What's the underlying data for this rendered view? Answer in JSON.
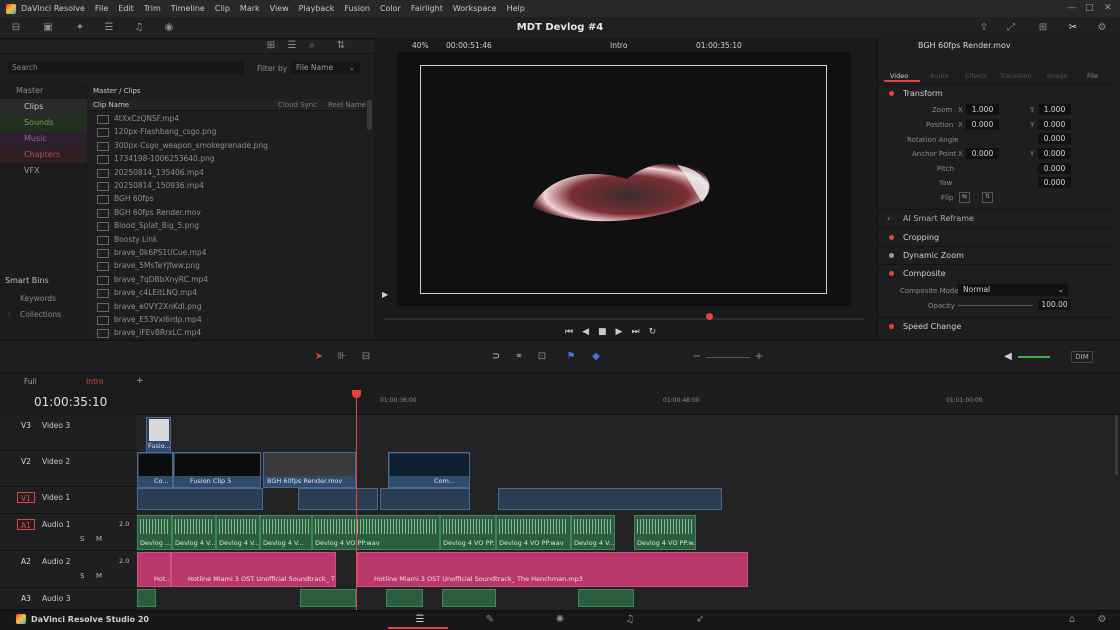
{
  "app": {
    "name": "DaVinci Resolve",
    "edition": "DaVinci Resolve Studio 20",
    "project_title": "MDT Devlog #4"
  },
  "menu": [
    "DaVinci Resolve",
    "File",
    "Edit",
    "Trim",
    "Timeline",
    "Clip",
    "Mark",
    "View",
    "Playback",
    "Fusion",
    "Color",
    "Fairlight",
    "Workspace",
    "Help"
  ],
  "media_pool": {
    "search_placeholder": "Search",
    "filter_label": "Filter by",
    "filter_value": "File Name",
    "path": "Master / Clips",
    "columns": [
      "Clip Name",
      "Cloud Sync",
      "Reel Name"
    ],
    "bins": [
      {
        "label": "Master",
        "color": "#8a8a8c"
      },
      {
        "label": "Clips",
        "color": "#d0d0d2"
      },
      {
        "label": "Sounds",
        "color": "#6fa35a"
      },
      {
        "label": "Music",
        "color": "#a35aa8"
      },
      {
        "label": "Chapters",
        "color": "#b2506a"
      },
      {
        "label": "VFX",
        "color": "#9a9a9c"
      }
    ],
    "smart_bins_title": "Smart Bins",
    "smart_bins": [
      "Keywords",
      "Collections"
    ],
    "clips": [
      "4tXxCzQNSF.mp4",
      "120px-Flashbang_csgo.png",
      "300px-Csgo_weapon_smokegrenade.png",
      "1734198-1006253640.png",
      "20250814_135406.mp4",
      "20250814_150936.mp4",
      "BGH 60fps",
      "BGH 60fps Render.mov",
      "Blood_Splat_Big_5.png",
      "Boosty Link",
      "brave_0k6PS1UCue.mp4",
      "brave_5MsTeYJfww.png",
      "brave_7qDBbXnyRC.mp4",
      "brave_c4LEitLNQ.mp4",
      "brave_e0VY2XnKdI.png",
      "brave_E53Vxl6rdp.mp4",
      "brave_iFEvBRrxLC.mp4"
    ]
  },
  "viewer": {
    "zoom": "40%",
    "source_timecode": "00:00:51:46",
    "timeline_name": "Intro",
    "record_timecode": "01:00:35:10"
  },
  "inspector": {
    "clip_name": "BGH 60fps Render.mov",
    "tabs": [
      "Video",
      "Audio",
      "Effects",
      "Transition",
      "Image",
      "File"
    ],
    "active_tab": "Video",
    "transform_title": "Transform",
    "zoom": {
      "label": "Zoom",
      "x": "1.000",
      "y": "1.000"
    },
    "position": {
      "label": "Position",
      "x": "0.000",
      "y": "0.000"
    },
    "rotation": {
      "label": "Rotation Angle",
      "value": "0.000"
    },
    "anchor": {
      "label": "Anchor Point",
      "x": "0.000",
      "y": "0.000"
    },
    "pitch": {
      "label": "Pitch",
      "value": "0.000"
    },
    "yaw": {
      "label": "Yaw",
      "value": "0.000"
    },
    "flip_label": "Flip",
    "ai_reframe": "AI Smart Reframe",
    "cropping": "Cropping",
    "dynamic_zoom": "Dynamic Zoom",
    "composite": "Composite",
    "composite_mode_label": "Composite Mode",
    "composite_mode_value": "Normal",
    "opacity_label": "Opacity",
    "opacity_value": "100.00",
    "speed_change": "Speed Change",
    "xlabel": "X",
    "ylabel": "Y"
  },
  "timeline": {
    "tabs": [
      "Full",
      "Intro"
    ],
    "active_tab": "Intro",
    "timecode": "01:00:35:10",
    "ruler": [
      "01:00:36:00",
      "01:00:48:00",
      "01:01:00:00"
    ],
    "dim_label": "DIM",
    "tracks": [
      {
        "id": "V3",
        "name": "Video 3"
      },
      {
        "id": "V2",
        "name": "Video 2"
      },
      {
        "id": "V1",
        "name": "Video 1"
      },
      {
        "id": "A1",
        "name": "Audio 1",
        "level": "2.0"
      },
      {
        "id": "A2",
        "name": "Audio 2",
        "level": "2.0"
      },
      {
        "id": "A3",
        "name": "Audio 3",
        "level": "2.0"
      }
    ],
    "clips": {
      "v3": "Fusio...",
      "v2_a": "Co...",
      "v2_b": "Fusion Clip 5",
      "v2_c": "BGH 60fps Render.mov",
      "v2_d": "Com...",
      "a1": [
        "Devlog ...",
        "Devlog 4 V...",
        "Devlog 4 V...",
        "Devlog 4 V...",
        "Devlog 4 VO PP.wav",
        "Devlog 4 VO PP...",
        "Devlog 4 VO PP.wav",
        "Devlog 4 V...",
        "Devlog 4 VO PP.w..."
      ],
      "a2_a": "Hot...",
      "a2_b": "Hotline Miami 3 OST Unofficial Soundtrack_ Th...",
      "a2_c": "Hotline Miami 3 OST Unofficial Soundtrack_ The Henchman.mp3",
      "smS": "S",
      "smM": "M"
    }
  },
  "colors": {
    "accent_red": "#e0443a",
    "video_clip": "#2f4b6e",
    "audio_clip": "#2a5e3e",
    "music_clip": "#b8386c"
  }
}
